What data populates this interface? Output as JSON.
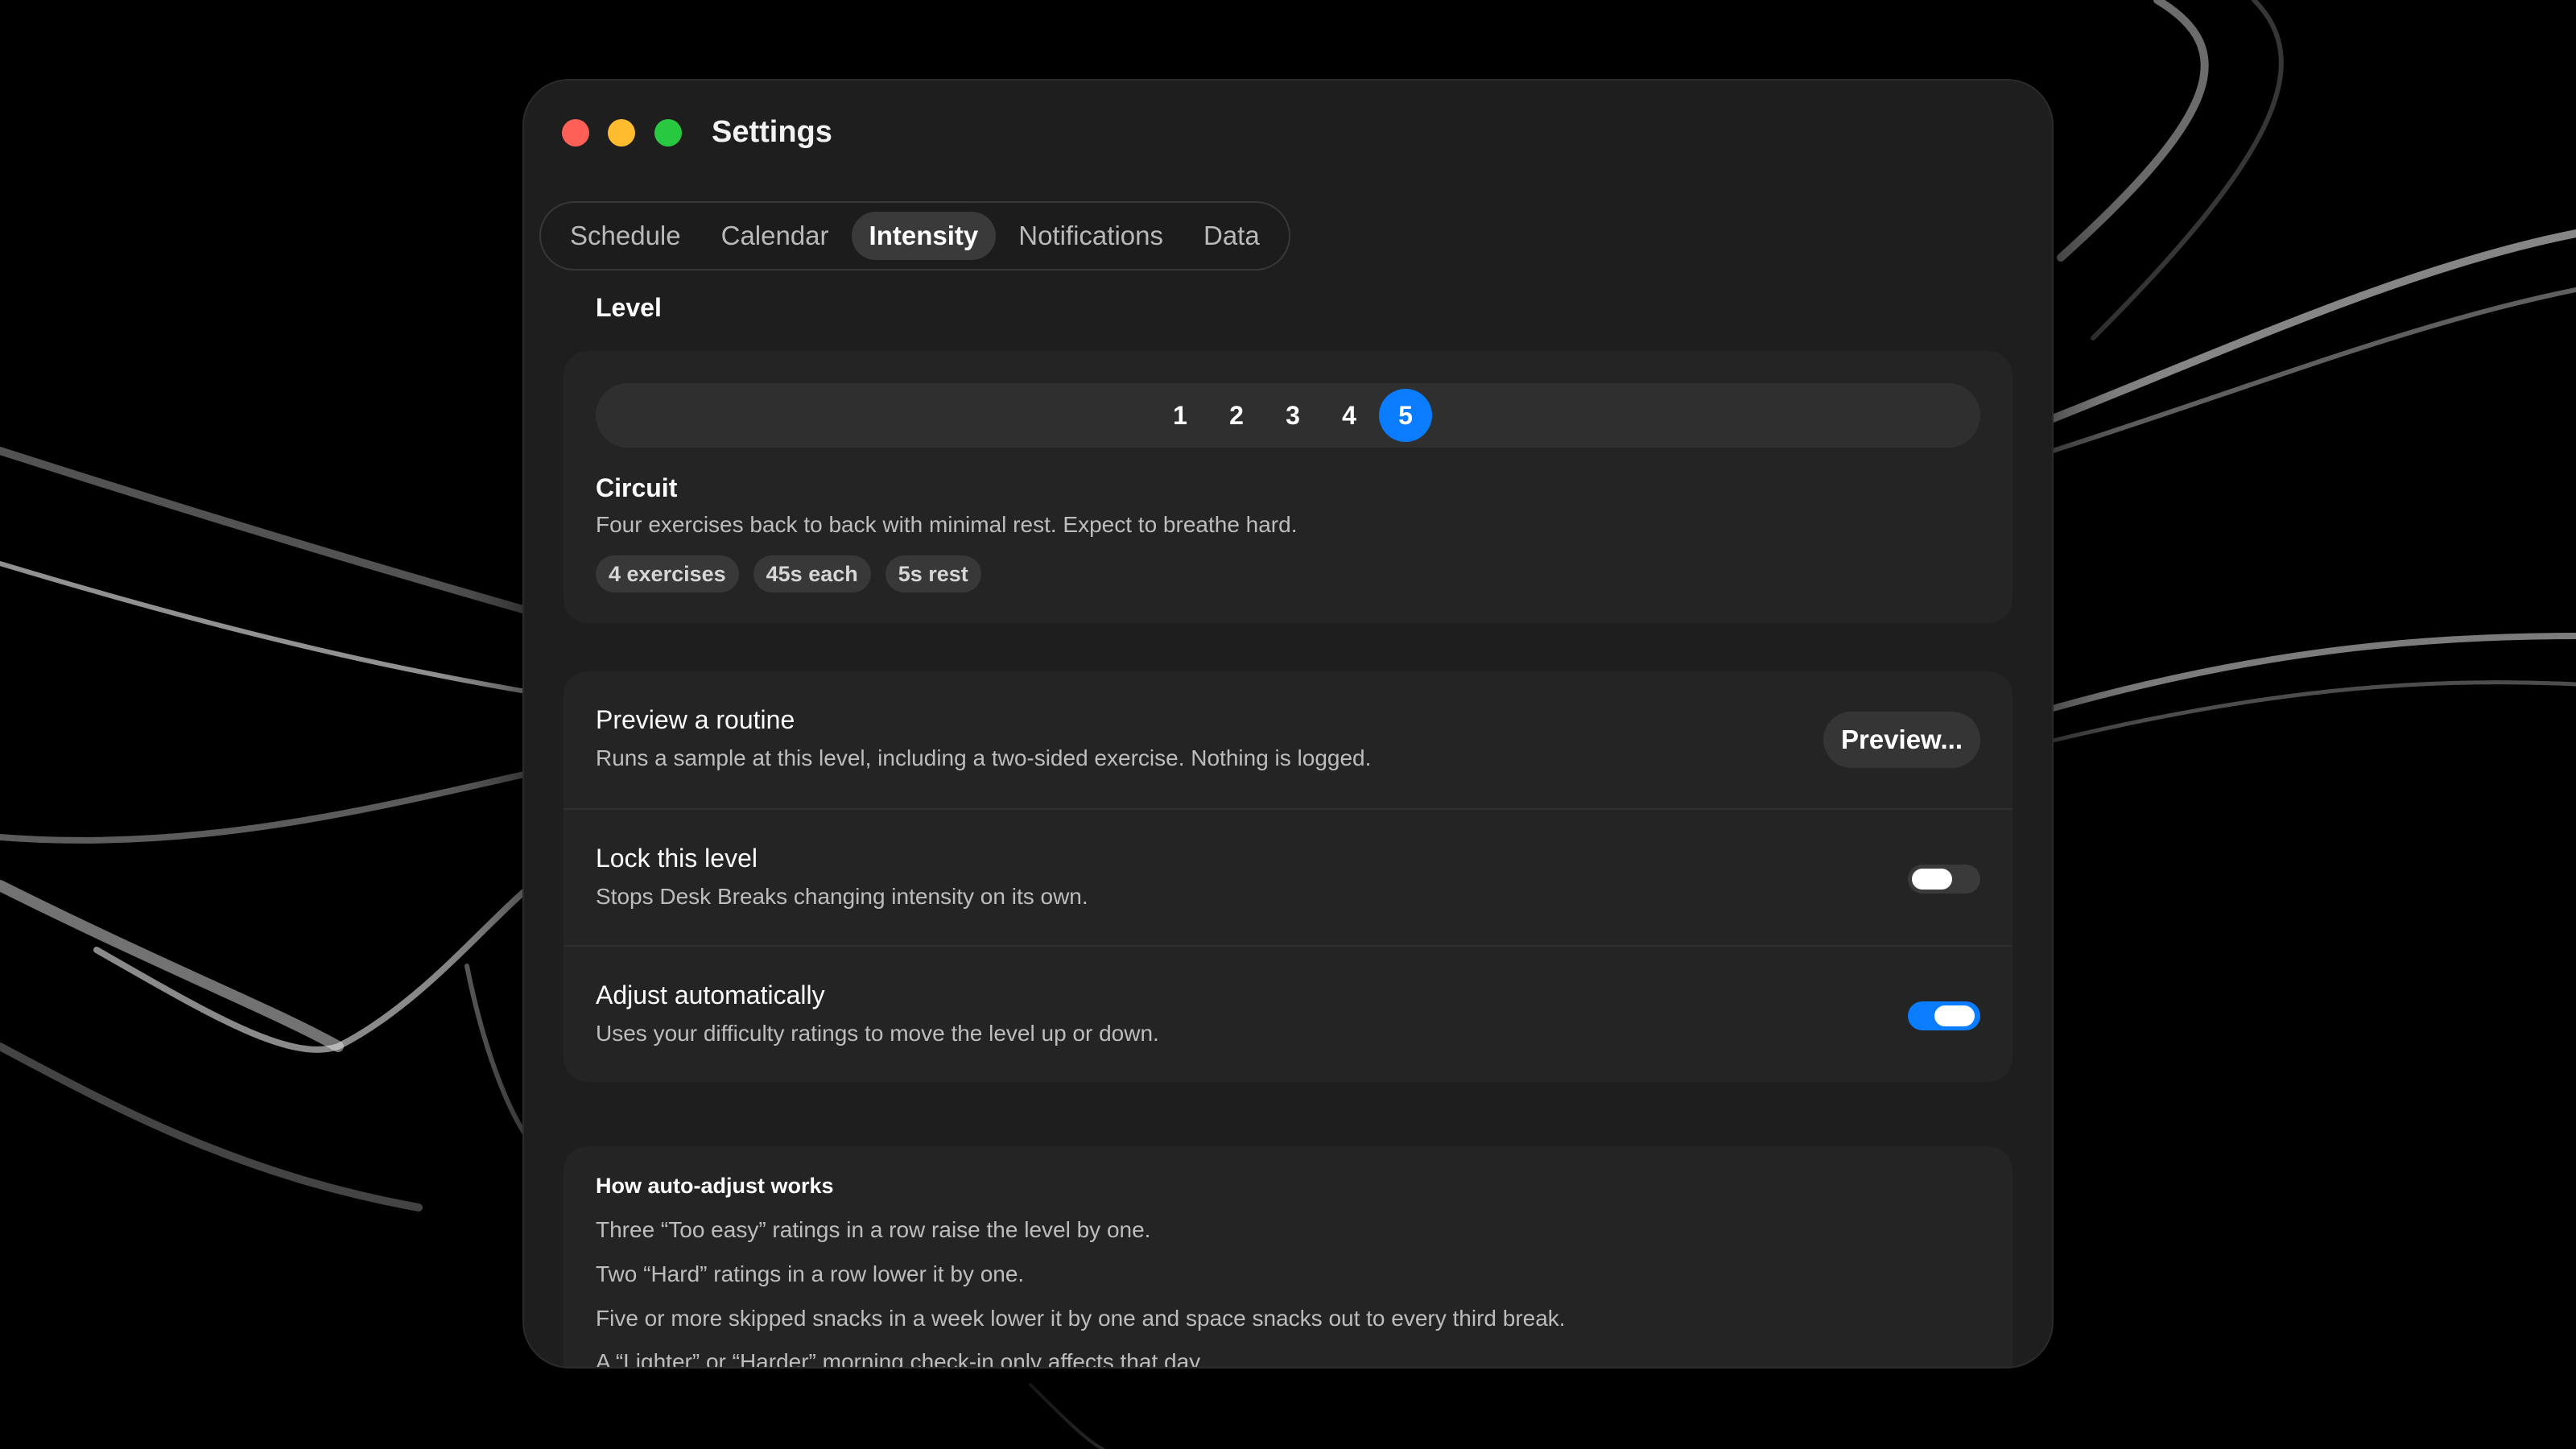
{
  "window": {
    "title": "Settings"
  },
  "tabs": [
    {
      "label": "Schedule"
    },
    {
      "label": "Calendar"
    },
    {
      "label": "Intensity"
    },
    {
      "label": "Notifications"
    },
    {
      "label": "Data"
    }
  ],
  "active_tab": "Intensity",
  "level_section": {
    "title": "Level",
    "steps": [
      "1",
      "2",
      "3",
      "4",
      "5"
    ],
    "selected": "5",
    "name": "Circuit",
    "description": "Four exercises back to back with minimal rest. Expect to breathe hard.",
    "chips": [
      "4 exercises",
      "45s each",
      "5s rest"
    ]
  },
  "settings": {
    "preview": {
      "title": "Preview a routine",
      "description": "Runs a sample at this level, including a two-sided exercise. Nothing is logged.",
      "button_label": "Preview..."
    },
    "lock": {
      "title": "Lock this level",
      "description": "Stops Desk Breaks changing intensity on its own.",
      "enabled": false
    },
    "auto": {
      "title": "Adjust automatically",
      "description": "Uses your difficulty ratings to move the level up or down.",
      "enabled": true
    }
  },
  "info": {
    "title": "How auto-adjust works",
    "lines": [
      "Three “Too easy” ratings in a row raise the level by one.",
      "Two “Hard” ratings in a row lower it by one.",
      "Five or more skipped snacks in a week lower it by one and space snacks out to every third break.",
      "A “Lighter” or “Harder” morning check-in only affects that day."
    ]
  },
  "colors": {
    "accent": "#0a7cff",
    "close": "#fe5f57",
    "minimize": "#febc2e",
    "maximize": "#28c840"
  }
}
